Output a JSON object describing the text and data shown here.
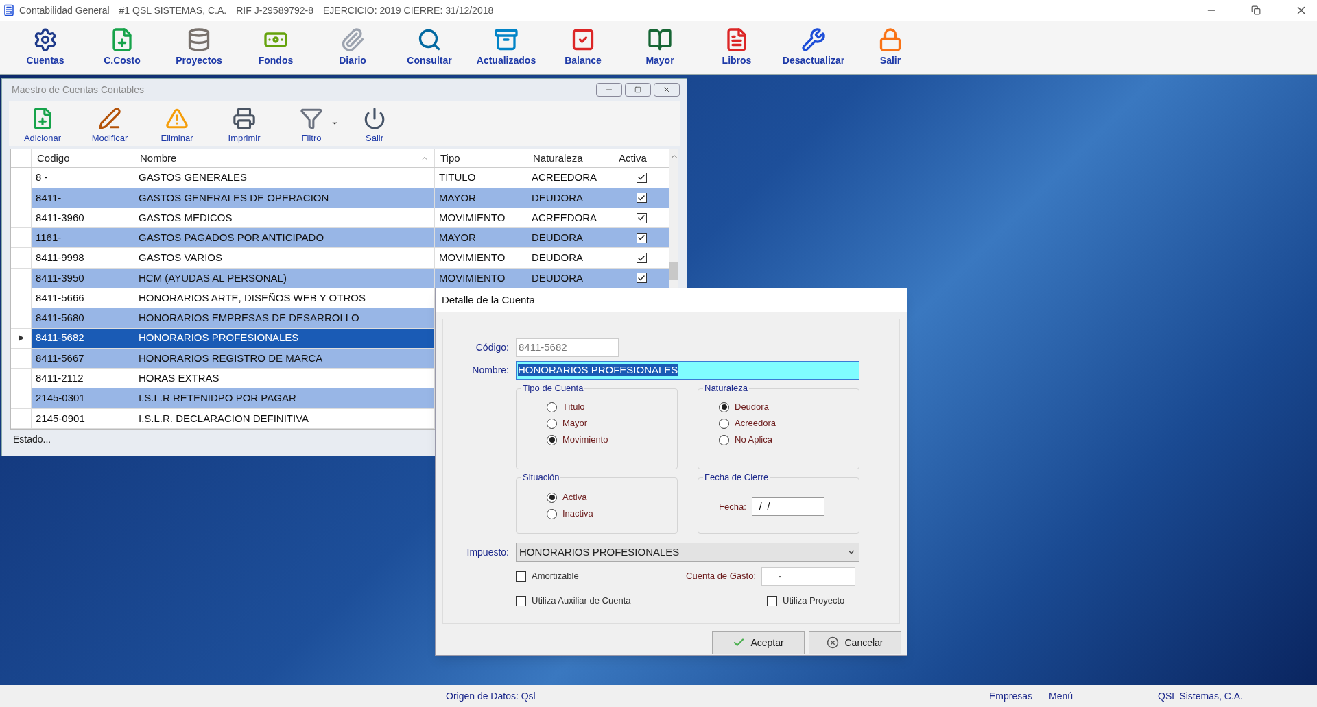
{
  "window": {
    "title": "Contabilidad General",
    "company": "#1  QSL SISTEMAS, C.A.",
    "rif": "RIF J-29589792-8",
    "period": "EJERCICIO: 2019 CIERRE: 31/12/2018"
  },
  "toolbar": [
    {
      "label": "Cuentas",
      "kind": "gear"
    },
    {
      "label": "C.Costo",
      "kind": "add"
    },
    {
      "label": "Proyectos",
      "kind": "coins"
    },
    {
      "label": "Fondos",
      "kind": "money"
    },
    {
      "label": "Diario",
      "kind": "clip"
    },
    {
      "label": "Consultar",
      "kind": "search"
    },
    {
      "label": "Actualizados",
      "kind": "cabinet"
    },
    {
      "label": "Balance",
      "kind": "check"
    },
    {
      "label": "Mayor",
      "kind": "book"
    },
    {
      "label": "Libros",
      "kind": "pdf"
    },
    {
      "label": "Desactualizar",
      "kind": "tools"
    },
    {
      "label": "Salir",
      "kind": "lock"
    }
  ],
  "master": {
    "title": "Maestro de Cuentas Contables",
    "toolbar": [
      {
        "label": "Adicionar",
        "kind": "add"
      },
      {
        "label": "Modificar",
        "kind": "edit"
      },
      {
        "label": "Eliminar",
        "kind": "warn"
      },
      {
        "label": "Imprimir",
        "kind": "print"
      },
      {
        "label": "Filtro",
        "kind": "filter"
      },
      {
        "label": "Salir",
        "kind": "power"
      }
    ],
    "columns": [
      "Codigo",
      "Nombre",
      "Tipo",
      "Naturaleza",
      "Activa"
    ],
    "rows": [
      {
        "codigo": "8  -",
        "nombre": "GASTOS GENERALES",
        "tipo": "TITULO",
        "naturaleza": "ACREEDORA",
        "activa": true,
        "selected": false
      },
      {
        "codigo": "8411-",
        "nombre": "GASTOS GENERALES DE OPERACION",
        "tipo": "MAYOR",
        "naturaleza": "DEUDORA",
        "activa": true,
        "selected": false
      },
      {
        "codigo": "8411-3960",
        "nombre": "GASTOS MEDICOS",
        "tipo": "MOVIMIENTO",
        "naturaleza": "ACREEDORA",
        "activa": true,
        "selected": false
      },
      {
        "codigo": "1161-",
        "nombre": "GASTOS PAGADOS POR ANTICIPADO",
        "tipo": "MAYOR",
        "naturaleza": "DEUDORA",
        "activa": true,
        "selected": false
      },
      {
        "codigo": "8411-9998",
        "nombre": "GASTOS VARIOS",
        "tipo": "MOVIMIENTO",
        "naturaleza": "DEUDORA",
        "activa": true,
        "selected": false
      },
      {
        "codigo": "8411-3950",
        "nombre": "HCM (AYUDAS AL PERSONAL)",
        "tipo": "MOVIMIENTO",
        "naturaleza": "DEUDORA",
        "activa": true,
        "selected": false
      },
      {
        "codigo": "8411-5666",
        "nombre": "HONORARIOS ARTE, DISEÑOS WEB Y OTROS",
        "selected": false
      },
      {
        "codigo": "8411-5680",
        "nombre": "HONORARIOS EMPRESAS DE DESARROLLO",
        "selected": false
      },
      {
        "codigo": "8411-5682",
        "nombre": "HONORARIOS PROFESIONALES",
        "selected": true
      },
      {
        "codigo": "8411-5667",
        "nombre": "HONORARIOS REGISTRO DE MARCA",
        "selected": false
      },
      {
        "codigo": "8411-2112",
        "nombre": "HORAS EXTRAS",
        "selected": false
      },
      {
        "codigo": "2145-0301",
        "nombre": "I.S.L.R RETENIDPO POR PAGAR",
        "selected": false
      },
      {
        "codigo": "2145-0901",
        "nombre": "I.S.L.R. DECLARACION DEFINITIVA",
        "selected": false
      }
    ],
    "status": "Estado..."
  },
  "dialog": {
    "title": "Detalle de la Cuenta",
    "codigo_label": "Código:",
    "codigo": "8411-5682",
    "nombre_label": "Nombre:",
    "nombre": "HONORARIOS PROFESIONALES",
    "tipo": {
      "title": "Tipo de Cuenta",
      "options": [
        {
          "label": "Título",
          "selected": false
        },
        {
          "label": "Mayor",
          "selected": false
        },
        {
          "label": "Movimiento",
          "selected": true
        }
      ]
    },
    "naturaleza": {
      "title": "Naturaleza",
      "options": [
        {
          "label": "Deudora",
          "selected": true
        },
        {
          "label": "Acreedora",
          "selected": false
        },
        {
          "label": "No Aplica",
          "selected": false
        }
      ]
    },
    "situacion": {
      "title": "Situación",
      "options": [
        {
          "label": "Activa",
          "selected": true
        },
        {
          "label": "Inactiva",
          "selected": false
        }
      ]
    },
    "fecha": {
      "title": "Fecha de Cierre",
      "label": "Fecha:",
      "value": "/  /"
    },
    "impuesto_label": "Impuesto:",
    "impuesto": "HONORARIOS PROFESIONALES",
    "amortizable": {
      "label": "Amortizable",
      "checked": false
    },
    "cuenta_gasto_label": "Cuenta de Gasto:",
    "cuenta_gasto": "-",
    "auxiliar": {
      "label": "Utiliza Auxiliar de Cuenta",
      "checked": false
    },
    "proyecto": {
      "label": "Utiliza Proyecto",
      "checked": false
    },
    "buttons": [
      {
        "label": "Aceptar",
        "kind": "ok"
      },
      {
        "label": "Cancelar",
        "kind": "cancel"
      }
    ]
  },
  "status_bar": {
    "source": "Origen de Datos: Qsl",
    "items": [
      "Empresas",
      "Menú"
    ],
    "company": "QSL Sistemas, C.A."
  }
}
